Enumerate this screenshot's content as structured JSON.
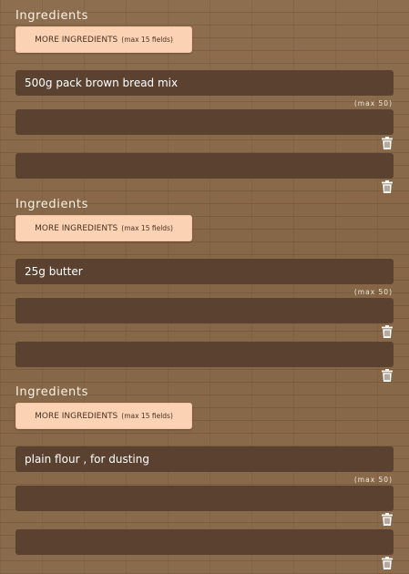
{
  "sections": [
    {
      "title": "Ingredients",
      "more_button": {
        "label": "MORE INGREDIENTS",
        "hint": "(max 15 fields)"
      },
      "fields": [
        {
          "value": "500g pack brown bread mix"
        },
        {
          "value": ""
        },
        {
          "value": ""
        }
      ],
      "max_hint": "(max 50)"
    },
    {
      "title": "Ingredients",
      "more_button": {
        "label": "MORE INGREDIENTS",
        "hint": "(max 15 fields)"
      },
      "fields": [
        {
          "value": "25g butter"
        },
        {
          "value": ""
        },
        {
          "value": ""
        }
      ],
      "max_hint": "(max 50)"
    },
    {
      "title": "Ingredients",
      "more_button": {
        "label": "MORE INGREDIENTS",
        "hint": "(max 15 fields)"
      },
      "fields": [
        {
          "value": "plain flour , for dusting"
        },
        {
          "value": ""
        },
        {
          "value": ""
        }
      ],
      "max_hint": "(max 50)"
    }
  ],
  "icons": {
    "remove_field": "trash-icon"
  },
  "colors": {
    "button_background": "#fcd2b4",
    "field_background": "#5b4230",
    "page_background": "#8a6b4c"
  }
}
